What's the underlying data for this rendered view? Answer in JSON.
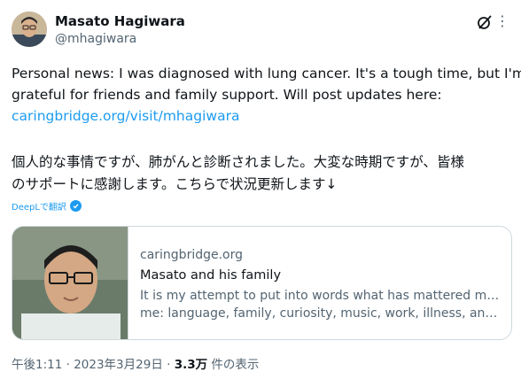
{
  "author": {
    "display_name": "Masato Hagiwara",
    "handle": "@mhagiwara"
  },
  "post": {
    "text_line1": "Personal news: I was diagnosed with lung cancer. It's a tough time, but I'm",
    "text_line2": "grateful for friends and family support. Will post updates here:",
    "link": "caringbridge.org/visit/mhagiwara",
    "jp_line1": "個人的な事情ですが、肺がんと診断されました。大変な時期ですが、皆様",
    "jp_line2": "のサポートに感謝します。こちらで状況更新します↓",
    "translate_label": "DeepLで翻訳"
  },
  "card": {
    "domain": "caringbridge.org",
    "title": "Masato and his family",
    "desc_line1": "It is my attempt to put into words what has mattered most to",
    "desc_line2": "me: language, family, curiosity, music, work, illness, and..."
  },
  "meta": {
    "time": "午後1:11",
    "sep1": " · ",
    "date": "2023年3月29日",
    "sep2": " · ",
    "views": "3.3万",
    "views_suffix": " 件の表示"
  },
  "icons": {
    "grok": "grok-icon",
    "more": "more-options-icon",
    "translate": "deepl-badge-icon"
  },
  "colors": {
    "link": "#1d9bf0",
    "secondary": "#536471",
    "primary": "#0f1419"
  }
}
